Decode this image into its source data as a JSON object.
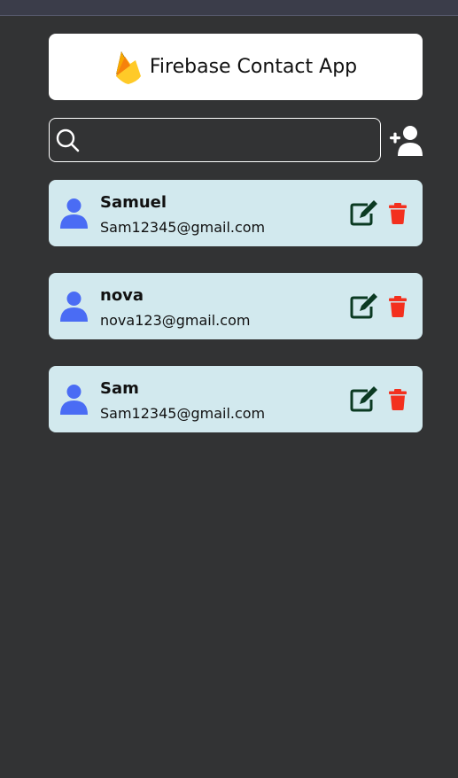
{
  "app": {
    "title": "Firebase Contact App",
    "logo_icon": "firebase-flame-icon"
  },
  "search": {
    "value": "",
    "placeholder": "",
    "icon": "search-icon"
  },
  "add_contact": {
    "icon": "add-user-icon"
  },
  "contacts": [
    {
      "name": "Samuel",
      "email": "Sam12345@gmail.com"
    },
    {
      "name": "nova",
      "email": "nova123@gmail.com"
    },
    {
      "name": "Sam",
      "email": "Sam12345@gmail.com"
    }
  ],
  "colors": {
    "background": "#323334",
    "card": "#d2e9ee",
    "avatar": "#4a6cf4",
    "edit": "#0b3a22",
    "delete": "#f3301e",
    "header_bg": "#ffffff"
  }
}
